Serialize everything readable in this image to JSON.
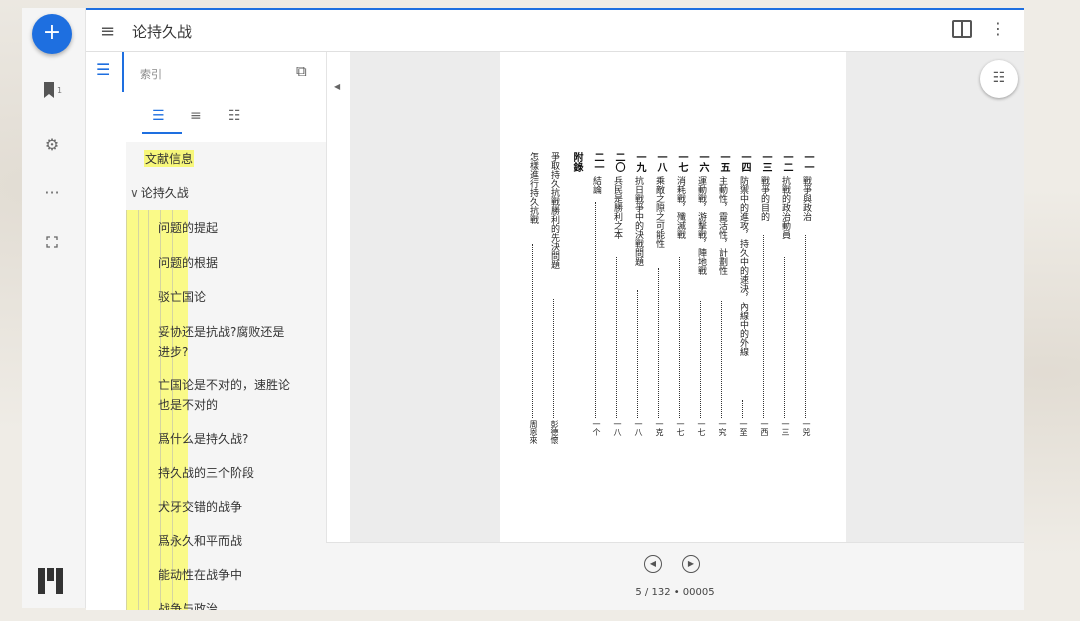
{
  "header": {
    "title": "论持久战"
  },
  "rail": {
    "fab": "+",
    "bookmark_badge": "1"
  },
  "panel": {
    "label": "索引",
    "doc_info": "文献信息",
    "root": "论持久战",
    "items": [
      "问题的提起",
      "问题的根据",
      "驳亡国论",
      [
        "妥协还是抗战?腐败还是",
        "进步?"
      ],
      [
        "亡国论是不对的，速胜论",
        "也是不对的"
      ],
      "爲什么是持久战?",
      "持久战的三个阶段",
      "犬牙交错的战争",
      "爲永久和平而战",
      "能动性在战争中",
      "战争与政治"
    ]
  },
  "footer": {
    "page_info": "5 / 132 • 00005"
  },
  "page_text": {
    "entries": [
      {
        "num": "一一",
        "title": "戰爭與政治",
        "page": "一兕"
      },
      {
        "num": "一二",
        "title": "抗戰的政治動員",
        "page": "一三"
      },
      {
        "num": "一三",
        "title": "戰爭的目的",
        "page": "一西"
      },
      {
        "num": "一四",
        "title": "防禦中的進攻，持久中的速決，內線中的外線",
        "page": "一至"
      },
      {
        "num": "一五",
        "title": "主動性，靈活性，計劃性",
        "page": "一究"
      },
      {
        "num": "一六",
        "title": "運動戰，游擊戰，陣地戰",
        "page": "一七"
      },
      {
        "num": "一七",
        "title": "消耗戰，殲滅戰",
        "page": "一七"
      },
      {
        "num": "一八",
        "title": "乘敵之隙之可能性",
        "page": "一克"
      },
      {
        "num": "一九",
        "title": "抗日戰爭中的決戰問題",
        "page": "一八"
      },
      {
        "num": "二〇",
        "title": "兵民是勝利之本",
        "page": "一八"
      },
      {
        "num": "二一",
        "title": "結論",
        "page": "一个"
      },
      {
        "num": "附錄",
        "title": "",
        "page": ""
      },
      {
        "num": "",
        "title": "爭取持久抗戰勝利的先決問題",
        "page": "彭德懷"
      },
      {
        "num": "",
        "title": "怎樣進行持久抗戰",
        "page": "周恩來"
      }
    ]
  },
  "colors": {
    "accent": "#1e6fe0",
    "highlight": "#fafa88"
  }
}
